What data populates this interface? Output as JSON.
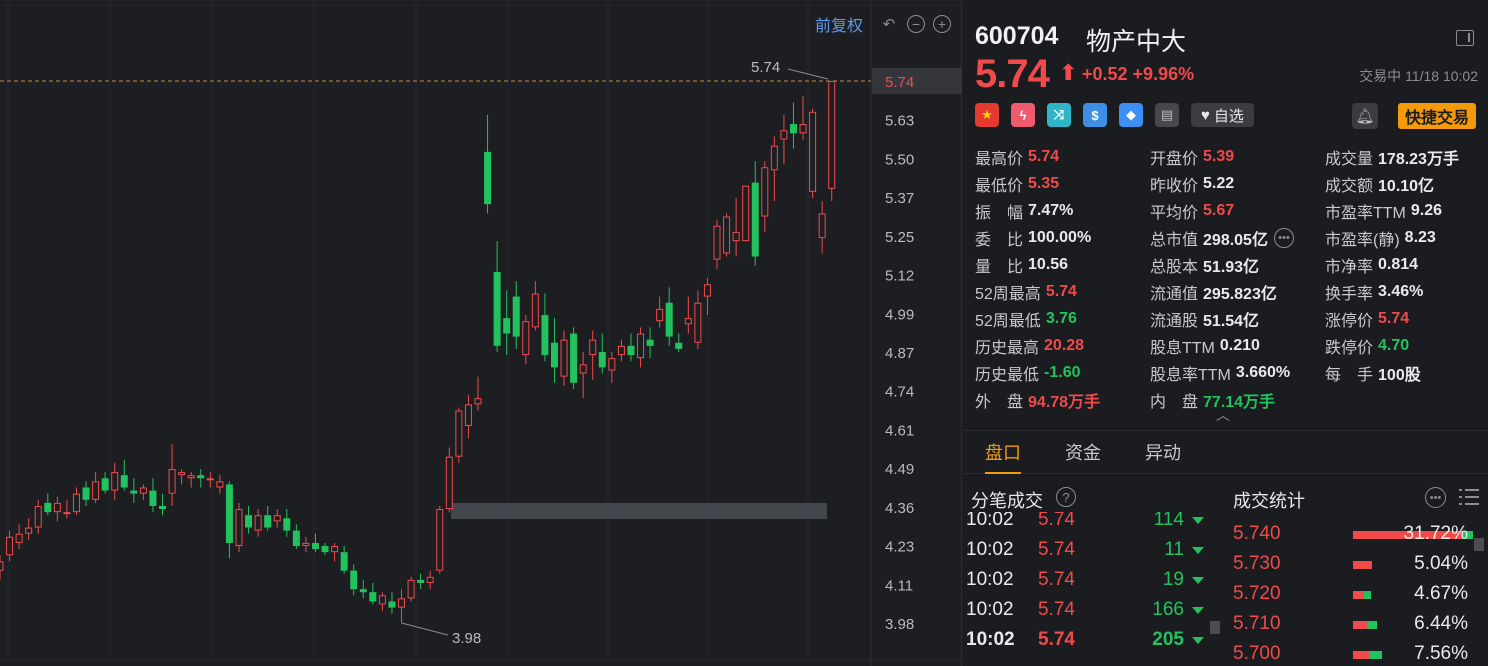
{
  "toolbar": {
    "adjust_label": "前复权",
    "icons": [
      "undo-icon",
      "zoom-out-icon",
      "zoom-in-icon"
    ]
  },
  "chart_data": {
    "type": "candlestick",
    "y_ticks": [
      "5.74",
      "5.63",
      "5.50",
      "5.37",
      "5.25",
      "5.12",
      "4.99",
      "4.87",
      "4.74",
      "4.61",
      "4.49",
      "4.36",
      "4.23",
      "4.11",
      "3.98"
    ],
    "current_price_label": "5.74",
    "high_annotation": "5.74",
    "low_annotation": "3.98",
    "ylim": [
      3.98,
      5.74
    ],
    "candles": [
      [
        4.15,
        4.2,
        4.12,
        4.18
      ],
      [
        4.2,
        4.28,
        4.18,
        4.26
      ],
      [
        4.24,
        4.3,
        4.22,
        4.27
      ],
      [
        4.27,
        4.32,
        4.25,
        4.29
      ],
      [
        4.29,
        4.38,
        4.27,
        4.36
      ],
      [
        4.37,
        4.4,
        4.33,
        4.34
      ],
      [
        4.34,
        4.39,
        4.31,
        4.37
      ],
      [
        4.34,
        4.38,
        4.32,
        4.34
      ],
      [
        4.34,
        4.42,
        4.33,
        4.4
      ],
      [
        4.42,
        4.44,
        4.36,
        4.38
      ],
      [
        4.38,
        4.47,
        4.37,
        4.44
      ],
      [
        4.45,
        4.47,
        4.4,
        4.41
      ],
      [
        4.41,
        4.5,
        4.38,
        4.47
      ],
      [
        4.46,
        4.51,
        4.41,
        4.42
      ],
      [
        4.41,
        4.45,
        4.37,
        4.4
      ],
      [
        4.4,
        4.43,
        4.38,
        4.42
      ],
      [
        4.41,
        4.45,
        4.34,
        4.36
      ],
      [
        4.36,
        4.4,
        4.33,
        4.35
      ],
      [
        4.4,
        4.56,
        4.36,
        4.48
      ],
      [
        4.46,
        4.48,
        4.43,
        4.47
      ],
      [
        4.45,
        4.47,
        4.42,
        4.46
      ],
      [
        4.46,
        4.48,
        4.42,
        4.45
      ],
      [
        4.45,
        4.47,
        4.42,
        4.45
      ],
      [
        4.42,
        4.46,
        4.4,
        4.44
      ],
      [
        4.43,
        4.44,
        4.19,
        4.24
      ],
      [
        4.23,
        4.37,
        4.21,
        4.35
      ],
      [
        4.33,
        4.36,
        4.27,
        4.29
      ],
      [
        4.28,
        4.35,
        4.26,
        4.33
      ],
      [
        4.33,
        4.36,
        4.28,
        4.29
      ],
      [
        4.31,
        4.35,
        4.29,
        4.33
      ],
      [
        4.32,
        4.35,
        4.26,
        4.28
      ],
      [
        4.28,
        4.3,
        4.22,
        4.23
      ],
      [
        4.23,
        4.26,
        4.21,
        4.24
      ],
      [
        4.24,
        4.27,
        4.21,
        4.22
      ],
      [
        4.23,
        4.24,
        4.2,
        4.21
      ],
      [
        4.21,
        4.24,
        4.18,
        4.23
      ],
      [
        4.21,
        4.23,
        4.14,
        4.15
      ],
      [
        4.15,
        4.17,
        4.07,
        4.09
      ],
      [
        4.09,
        4.12,
        4.06,
        4.08
      ],
      [
        4.08,
        4.11,
        4.04,
        4.05
      ],
      [
        4.04,
        4.08,
        4.02,
        4.07
      ],
      [
        4.05,
        4.08,
        4.01,
        4.03
      ],
      [
        4.03,
        4.09,
        3.98,
        4.06
      ],
      [
        4.06,
        4.13,
        4.05,
        4.12
      ],
      [
        4.12,
        4.14,
        4.09,
        4.11
      ],
      [
        4.11,
        4.15,
        4.09,
        4.13
      ],
      [
        4.15,
        4.36,
        4.14,
        4.35
      ],
      [
        4.35,
        4.55,
        4.34,
        4.52
      ],
      [
        4.52,
        4.68,
        4.5,
        4.67
      ],
      [
        4.62,
        4.72,
        4.58,
        4.69
      ],
      [
        4.69,
        4.78,
        4.67,
        4.71
      ],
      [
        5.51,
        5.63,
        5.31,
        5.34
      ],
      [
        5.12,
        5.22,
        4.86,
        4.88
      ],
      [
        4.97,
        5.06,
        4.85,
        4.92
      ],
      [
        5.04,
        5.09,
        4.87,
        4.91
      ],
      [
        4.85,
        4.98,
        4.82,
        4.96
      ],
      [
        4.94,
        5.09,
        4.93,
        5.05
      ],
      [
        4.98,
        5.05,
        4.83,
        4.85
      ],
      [
        4.89,
        4.97,
        4.76,
        4.81
      ],
      [
        4.78,
        4.93,
        4.75,
        4.9
      ],
      [
        4.92,
        4.94,
        4.74,
        4.76
      ],
      [
        4.79,
        4.86,
        4.71,
        4.82
      ],
      [
        4.85,
        4.93,
        4.77,
        4.9
      ],
      [
        4.86,
        4.92,
        4.79,
        4.81
      ],
      [
        4.8,
        4.86,
        4.76,
        4.84
      ],
      [
        4.85,
        4.9,
        4.83,
        4.88
      ],
      [
        4.88,
        4.92,
        4.83,
        4.85
      ],
      [
        4.84,
        4.94,
        4.81,
        4.92
      ],
      [
        4.9,
        4.94,
        4.84,
        4.88
      ],
      [
        4.96,
        5.04,
        4.94,
        5.0
      ],
      [
        5.02,
        5.07,
        4.88,
        4.91
      ],
      [
        4.89,
        4.92,
        4.86,
        4.87
      ],
      [
        4.95,
        5.04,
        4.92,
        4.97
      ],
      [
        4.89,
        5.06,
        4.87,
        5.02
      ],
      [
        5.04,
        5.1,
        4.98,
        5.08
      ],
      [
        5.16,
        5.29,
        5.13,
        5.27
      ],
      [
        5.18,
        5.31,
        5.17,
        5.3
      ],
      [
        5.22,
        5.36,
        5.17,
        5.25
      ],
      [
        5.22,
        5.38,
        5.22,
        5.4
      ],
      [
        5.41,
        5.48,
        5.14,
        5.17
      ],
      [
        5.3,
        5.48,
        5.25,
        5.46
      ],
      [
        5.45,
        5.56,
        5.35,
        5.53
      ],
      [
        5.55,
        5.63,
        5.47,
        5.58
      ],
      [
        5.6,
        5.67,
        5.52,
        5.57
      ],
      [
        5.57,
        5.69,
        5.55,
        5.6
      ],
      [
        5.38,
        5.65,
        5.36,
        5.64
      ],
      [
        5.23,
        5.35,
        5.18,
        5.31
      ],
      [
        5.39,
        5.74,
        5.35,
        5.74
      ]
    ]
  },
  "quote": {
    "code": "600704",
    "name": "物产中大",
    "price": "5.74",
    "change": "+0.52 +9.96%",
    "status": "交易中 11/18 10:02",
    "fav_label": "自选",
    "quick_trade_label": "快捷交易",
    "badges": [
      "china-flag-icon",
      "margin-bolt-icon",
      "connect-shuffle-icon",
      "dollar-icon",
      "tag-icon",
      "notebook-icon"
    ],
    "stats": [
      [
        {
          "label": "最高价",
          "value": "5.74",
          "cls": "up"
        },
        {
          "label": "开盘价",
          "value": "5.39",
          "cls": "up"
        },
        {
          "label": "成交量",
          "value": "178.23万手",
          "cls": ""
        }
      ],
      [
        {
          "label": "最低价",
          "value": "5.35",
          "cls": "up"
        },
        {
          "label": "昨收价",
          "value": "5.22",
          "cls": ""
        },
        {
          "label": "成交额",
          "value": "10.10亿",
          "cls": ""
        }
      ],
      [
        {
          "label": "振　幅",
          "value": "7.47%",
          "cls": ""
        },
        {
          "label": "平均价",
          "value": "5.67",
          "cls": "up"
        },
        {
          "label": "市盈率TTM",
          "value": "9.26",
          "cls": ""
        }
      ],
      [
        {
          "label": "委　比",
          "value": "100.00%",
          "cls": ""
        },
        {
          "label": "总市值",
          "value": "298.05亿",
          "cls": ""
        },
        {
          "label": "市盈率(静)",
          "value": "8.23",
          "cls": ""
        }
      ],
      [
        {
          "label": "量　比",
          "value": "10.56",
          "cls": ""
        },
        {
          "label": "总股本",
          "value": "51.93亿",
          "cls": ""
        },
        {
          "label": "市净率",
          "value": "0.814",
          "cls": ""
        }
      ],
      [
        {
          "label": "52周最高",
          "value": "5.74",
          "cls": "up"
        },
        {
          "label": "流通值",
          "value": "295.823亿",
          "cls": ""
        },
        {
          "label": "换手率",
          "value": "3.46%",
          "cls": ""
        }
      ],
      [
        {
          "label": "52周最低",
          "value": "3.76",
          "cls": "down"
        },
        {
          "label": "流通股",
          "value": "51.54亿",
          "cls": ""
        },
        {
          "label": "涨停价",
          "value": "5.74",
          "cls": "up"
        }
      ],
      [
        {
          "label": "历史最高",
          "value": "20.28",
          "cls": "up"
        },
        {
          "label": "股息TTM",
          "value": "0.210",
          "cls": ""
        },
        {
          "label": "跌停价",
          "value": "4.70",
          "cls": "down"
        }
      ],
      [
        {
          "label": "历史最低",
          "value": "-1.60",
          "cls": "down"
        },
        {
          "label": "股息率TTM",
          "value": "3.660%",
          "cls": ""
        },
        {
          "label": "每　手",
          "value": "100股",
          "cls": ""
        }
      ],
      [
        {
          "label": "外　盘",
          "value": "94.78万手",
          "cls": "up"
        },
        {
          "label": "内　盘",
          "value": "77.14万手",
          "cls": "down"
        },
        {
          "label": "",
          "value": "",
          "cls": ""
        }
      ]
    ]
  },
  "tabs": [
    "盘口",
    "资金",
    "异动"
  ],
  "ticks_panel": {
    "title": "分笔成交",
    "rows": [
      {
        "time": "10:02",
        "price": "5.74",
        "vol": "114"
      },
      {
        "time": "10:02",
        "price": "5.74",
        "vol": "11"
      },
      {
        "time": "10:02",
        "price": "5.74",
        "vol": "19"
      },
      {
        "time": "10:02",
        "price": "5.74",
        "vol": "166"
      },
      {
        "time": "10:02",
        "price": "5.74",
        "vol": "205"
      }
    ]
  },
  "dist_panel": {
    "title": "成交统计",
    "rows": [
      {
        "price": "5.740",
        "pct": "31.72%",
        "up": 0.9,
        "down": 0.1
      },
      {
        "price": "5.730",
        "pct": "5.04%",
        "up": 1.0,
        "down": 0.0
      },
      {
        "price": "5.720",
        "pct": "4.67%",
        "up": 0.6,
        "down": 0.4
      },
      {
        "price": "5.710",
        "pct": "6.44%",
        "up": 0.6,
        "down": 0.4
      },
      {
        "price": "5.700",
        "pct": "7.56%",
        "up": 0.6,
        "down": 0.4
      }
    ]
  },
  "colors": {
    "up": "#f04a4a",
    "down": "#22c35e",
    "accent": "#f59a0b",
    "link": "#5b9bf0"
  }
}
